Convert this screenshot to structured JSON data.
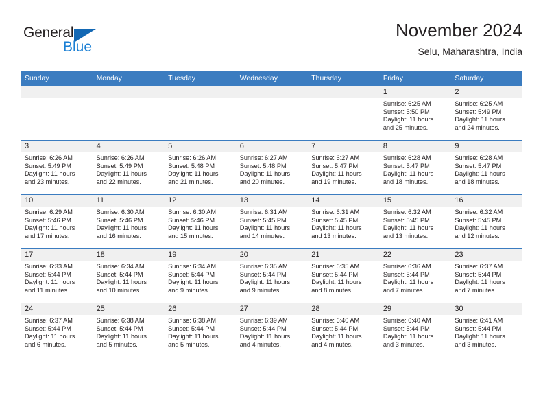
{
  "brand": {
    "name_part1": "General",
    "name_part2": "Blue",
    "triangle_color": "#1368b4",
    "blue_text_color": "#1a7fd4"
  },
  "header": {
    "title": "November 2024",
    "subtitle": "Selu, Maharashtra, India"
  },
  "theme": {
    "header_blue": "#3b7cc0",
    "daynum_band": "#f0f0f0",
    "text": "#231f20"
  },
  "weekdays": [
    "Sunday",
    "Monday",
    "Tuesday",
    "Wednesday",
    "Thursday",
    "Friday",
    "Saturday"
  ],
  "weeks": [
    [
      {
        "day": "",
        "sunrise": "",
        "sunset": "",
        "daylight_line1": "",
        "daylight_line2": ""
      },
      {
        "day": "",
        "sunrise": "",
        "sunset": "",
        "daylight_line1": "",
        "daylight_line2": ""
      },
      {
        "day": "",
        "sunrise": "",
        "sunset": "",
        "daylight_line1": "",
        "daylight_line2": ""
      },
      {
        "day": "",
        "sunrise": "",
        "sunset": "",
        "daylight_line1": "",
        "daylight_line2": ""
      },
      {
        "day": "",
        "sunrise": "",
        "sunset": "",
        "daylight_line1": "",
        "daylight_line2": ""
      },
      {
        "day": "1",
        "sunrise": "Sunrise: 6:25 AM",
        "sunset": "Sunset: 5:50 PM",
        "daylight_line1": "Daylight: 11 hours",
        "daylight_line2": "and 25 minutes."
      },
      {
        "day": "2",
        "sunrise": "Sunrise: 6:25 AM",
        "sunset": "Sunset: 5:49 PM",
        "daylight_line1": "Daylight: 11 hours",
        "daylight_line2": "and 24 minutes."
      }
    ],
    [
      {
        "day": "3",
        "sunrise": "Sunrise: 6:26 AM",
        "sunset": "Sunset: 5:49 PM",
        "daylight_line1": "Daylight: 11 hours",
        "daylight_line2": "and 23 minutes."
      },
      {
        "day": "4",
        "sunrise": "Sunrise: 6:26 AM",
        "sunset": "Sunset: 5:49 PM",
        "daylight_line1": "Daylight: 11 hours",
        "daylight_line2": "and 22 minutes."
      },
      {
        "day": "5",
        "sunrise": "Sunrise: 6:26 AM",
        "sunset": "Sunset: 5:48 PM",
        "daylight_line1": "Daylight: 11 hours",
        "daylight_line2": "and 21 minutes."
      },
      {
        "day": "6",
        "sunrise": "Sunrise: 6:27 AM",
        "sunset": "Sunset: 5:48 PM",
        "daylight_line1": "Daylight: 11 hours",
        "daylight_line2": "and 20 minutes."
      },
      {
        "day": "7",
        "sunrise": "Sunrise: 6:27 AM",
        "sunset": "Sunset: 5:47 PM",
        "daylight_line1": "Daylight: 11 hours",
        "daylight_line2": "and 19 minutes."
      },
      {
        "day": "8",
        "sunrise": "Sunrise: 6:28 AM",
        "sunset": "Sunset: 5:47 PM",
        "daylight_line1": "Daylight: 11 hours",
        "daylight_line2": "and 18 minutes."
      },
      {
        "day": "9",
        "sunrise": "Sunrise: 6:28 AM",
        "sunset": "Sunset: 5:47 PM",
        "daylight_line1": "Daylight: 11 hours",
        "daylight_line2": "and 18 minutes."
      }
    ],
    [
      {
        "day": "10",
        "sunrise": "Sunrise: 6:29 AM",
        "sunset": "Sunset: 5:46 PM",
        "daylight_line1": "Daylight: 11 hours",
        "daylight_line2": "and 17 minutes."
      },
      {
        "day": "11",
        "sunrise": "Sunrise: 6:30 AM",
        "sunset": "Sunset: 5:46 PM",
        "daylight_line1": "Daylight: 11 hours",
        "daylight_line2": "and 16 minutes."
      },
      {
        "day": "12",
        "sunrise": "Sunrise: 6:30 AM",
        "sunset": "Sunset: 5:46 PM",
        "daylight_line1": "Daylight: 11 hours",
        "daylight_line2": "and 15 minutes."
      },
      {
        "day": "13",
        "sunrise": "Sunrise: 6:31 AM",
        "sunset": "Sunset: 5:45 PM",
        "daylight_line1": "Daylight: 11 hours",
        "daylight_line2": "and 14 minutes."
      },
      {
        "day": "14",
        "sunrise": "Sunrise: 6:31 AM",
        "sunset": "Sunset: 5:45 PM",
        "daylight_line1": "Daylight: 11 hours",
        "daylight_line2": "and 13 minutes."
      },
      {
        "day": "15",
        "sunrise": "Sunrise: 6:32 AM",
        "sunset": "Sunset: 5:45 PM",
        "daylight_line1": "Daylight: 11 hours",
        "daylight_line2": "and 13 minutes."
      },
      {
        "day": "16",
        "sunrise": "Sunrise: 6:32 AM",
        "sunset": "Sunset: 5:45 PM",
        "daylight_line1": "Daylight: 11 hours",
        "daylight_line2": "and 12 minutes."
      }
    ],
    [
      {
        "day": "17",
        "sunrise": "Sunrise: 6:33 AM",
        "sunset": "Sunset: 5:44 PM",
        "daylight_line1": "Daylight: 11 hours",
        "daylight_line2": "and 11 minutes."
      },
      {
        "day": "18",
        "sunrise": "Sunrise: 6:34 AM",
        "sunset": "Sunset: 5:44 PM",
        "daylight_line1": "Daylight: 11 hours",
        "daylight_line2": "and 10 minutes."
      },
      {
        "day": "19",
        "sunrise": "Sunrise: 6:34 AM",
        "sunset": "Sunset: 5:44 PM",
        "daylight_line1": "Daylight: 11 hours",
        "daylight_line2": "and 9 minutes."
      },
      {
        "day": "20",
        "sunrise": "Sunrise: 6:35 AM",
        "sunset": "Sunset: 5:44 PM",
        "daylight_line1": "Daylight: 11 hours",
        "daylight_line2": "and 9 minutes."
      },
      {
        "day": "21",
        "sunrise": "Sunrise: 6:35 AM",
        "sunset": "Sunset: 5:44 PM",
        "daylight_line1": "Daylight: 11 hours",
        "daylight_line2": "and 8 minutes."
      },
      {
        "day": "22",
        "sunrise": "Sunrise: 6:36 AM",
        "sunset": "Sunset: 5:44 PM",
        "daylight_line1": "Daylight: 11 hours",
        "daylight_line2": "and 7 minutes."
      },
      {
        "day": "23",
        "sunrise": "Sunrise: 6:37 AM",
        "sunset": "Sunset: 5:44 PM",
        "daylight_line1": "Daylight: 11 hours",
        "daylight_line2": "and 7 minutes."
      }
    ],
    [
      {
        "day": "24",
        "sunrise": "Sunrise: 6:37 AM",
        "sunset": "Sunset: 5:44 PM",
        "daylight_line1": "Daylight: 11 hours",
        "daylight_line2": "and 6 minutes."
      },
      {
        "day": "25",
        "sunrise": "Sunrise: 6:38 AM",
        "sunset": "Sunset: 5:44 PM",
        "daylight_line1": "Daylight: 11 hours",
        "daylight_line2": "and 5 minutes."
      },
      {
        "day": "26",
        "sunrise": "Sunrise: 6:38 AM",
        "sunset": "Sunset: 5:44 PM",
        "daylight_line1": "Daylight: 11 hours",
        "daylight_line2": "and 5 minutes."
      },
      {
        "day": "27",
        "sunrise": "Sunrise: 6:39 AM",
        "sunset": "Sunset: 5:44 PM",
        "daylight_line1": "Daylight: 11 hours",
        "daylight_line2": "and 4 minutes."
      },
      {
        "day": "28",
        "sunrise": "Sunrise: 6:40 AM",
        "sunset": "Sunset: 5:44 PM",
        "daylight_line1": "Daylight: 11 hours",
        "daylight_line2": "and 4 minutes."
      },
      {
        "day": "29",
        "sunrise": "Sunrise: 6:40 AM",
        "sunset": "Sunset: 5:44 PM",
        "daylight_line1": "Daylight: 11 hours",
        "daylight_line2": "and 3 minutes."
      },
      {
        "day": "30",
        "sunrise": "Sunrise: 6:41 AM",
        "sunset": "Sunset: 5:44 PM",
        "daylight_line1": "Daylight: 11 hours",
        "daylight_line2": "and 3 minutes."
      }
    ]
  ]
}
